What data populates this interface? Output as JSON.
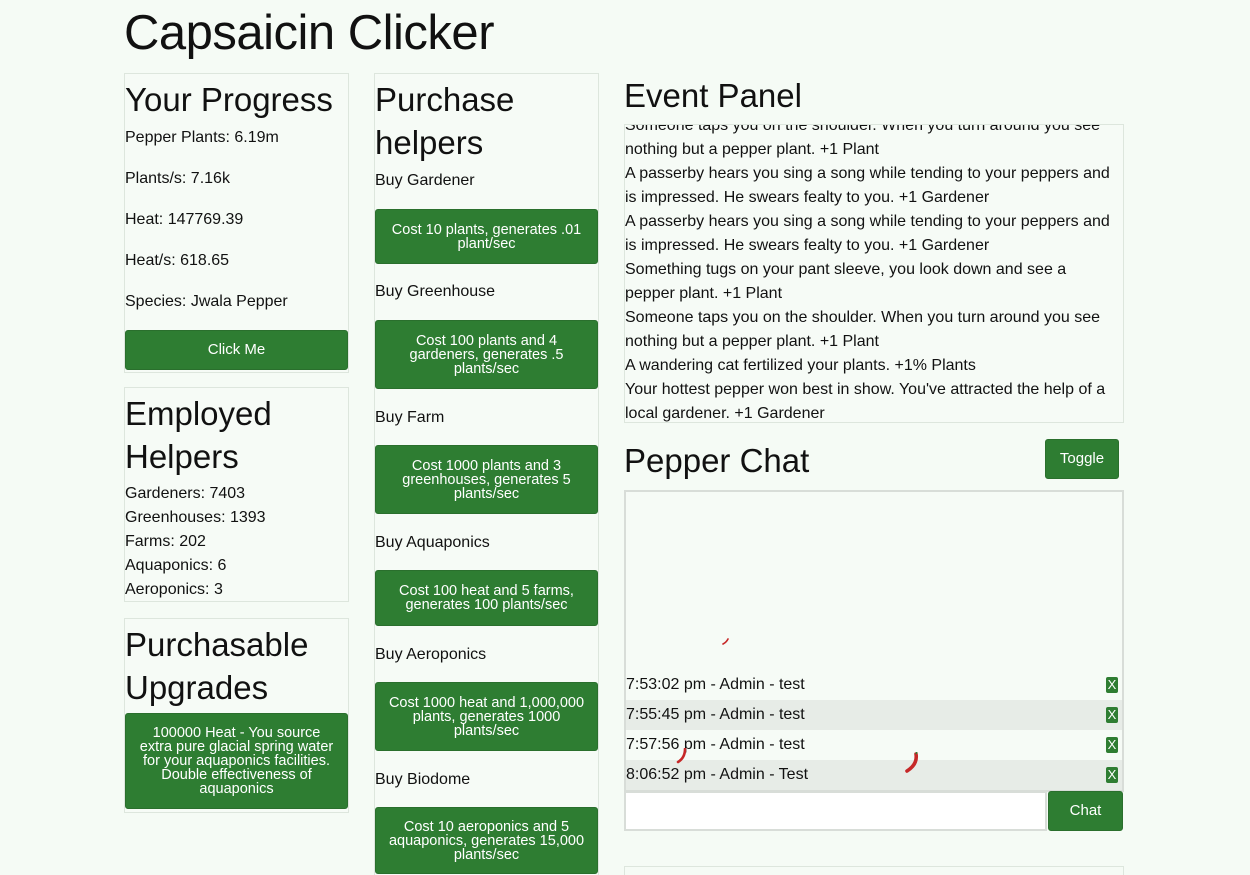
{
  "app": {
    "title": "Capsaicin Clicker"
  },
  "progress": {
    "heading": "Your Progress",
    "stats": [
      "Pepper Plants: 6.19m",
      "Plants/s: 7.16k",
      "Heat: 147769.39",
      "Heat/s: 618.65",
      "Species: Jwala Pepper"
    ],
    "click_label": "Click Me"
  },
  "employed": {
    "heading": "Employed Helpers",
    "stats": [
      "Gardeners: 7403",
      "Greenhouses: 1393",
      "Farms: 202",
      "Aquaponics: 6",
      "Aeroponics: 3"
    ]
  },
  "upgrades": {
    "heading": "Purchasable Upgrades",
    "items": [
      "100000 Heat - You source extra pure glacial spring water for your aquaponics facilities. Double effectiveness of aquaponics"
    ]
  },
  "purchase": {
    "heading": "Purchase helpers",
    "helpers": [
      {
        "label": "Buy Gardener",
        "button": "Cost 10 plants, generates .01 plant/sec"
      },
      {
        "label": "Buy Greenhouse",
        "button": "Cost 100 plants and 4 gardeners, generates .5 plants/sec"
      },
      {
        "label": "Buy Farm",
        "button": "Cost 1000 plants and 3 greenhouses, generates 5 plants/sec"
      },
      {
        "label": "Buy Aquaponics",
        "button": "Cost 100 heat and 5 farms, generates 100 plants/sec"
      },
      {
        "label": "Buy Aeroponics",
        "button": "Cost 1000 heat and 1,000,000 plants, generates 1000 plants/sec"
      },
      {
        "label": "Buy Biodome",
        "button": "Cost 10 aeroponics and 5 aquaponics, generates 15,000 plants/sec"
      }
    ]
  },
  "events": {
    "heading": "Event Panel",
    "lines": [
      "Someone taps you on the shoulder. When you turn around you see",
      "nothing but a pepper plant. +1 Plant",
      "A passerby hears you sing a song while tending to your peppers and",
      "is impressed. He swears fealty to you. +1 Gardener",
      "A passerby hears you sing a song while tending to your peppers and",
      "is impressed. He swears fealty to you. +1 Gardener",
      "Something tugs on your pant sleeve, you look down and see a",
      "pepper plant. +1 Plant",
      "Someone taps you on the shoulder. When you turn around you see",
      "nothing but a pepper plant. +1 Plant",
      "A wandering cat fertilized your plants. +1% Plants",
      "Your hottest pepper won best in show. You've attracted the help of a",
      "local gardener. +1 Gardener"
    ]
  },
  "chat": {
    "heading": "Pepper Chat",
    "toggle_label": "Toggle",
    "messages": [
      {
        "text": "7:53:02 pm - Admin - test",
        "delete": "X"
      },
      {
        "text": "7:55:45 pm - Admin - test",
        "delete": "X"
      },
      {
        "text": "7:57:56 pm - Admin - test",
        "delete": "X"
      },
      {
        "text": "8:06:52 pm - Admin - Test",
        "delete": "X"
      }
    ],
    "input_value": "",
    "send_label": "Chat"
  },
  "colors": {
    "button": "#2e7d32",
    "background": "#f5fbf5",
    "pepper": "#c62828"
  }
}
